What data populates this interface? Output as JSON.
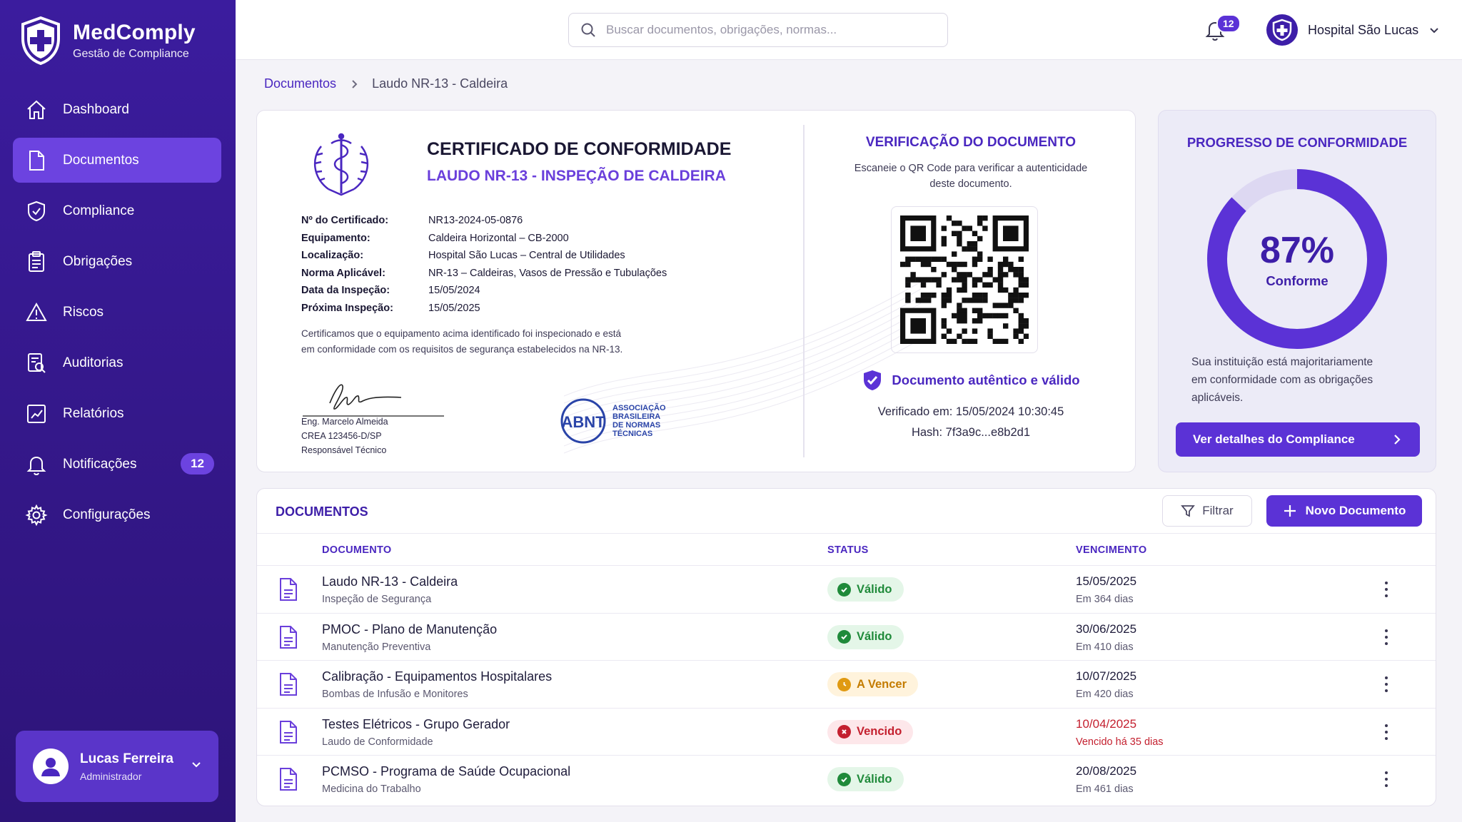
{
  "brand": {
    "name": "MedComply",
    "subtitle": "Gestão de Compliance"
  },
  "sidebar": {
    "items": [
      {
        "label": "Dashboard",
        "icon": "home-icon"
      },
      {
        "label": "Documentos",
        "icon": "document-icon",
        "active": true
      },
      {
        "label": "Compliance",
        "icon": "shield-check-icon"
      },
      {
        "label": "Obrigações",
        "icon": "clipboard-icon"
      },
      {
        "label": "Riscos",
        "icon": "warning-icon"
      },
      {
        "label": "Auditorias",
        "icon": "audit-icon"
      },
      {
        "label": "Relatórios",
        "icon": "chart-icon"
      },
      {
        "label": "Notificações",
        "icon": "bell-icon",
        "badge": "12"
      },
      {
        "label": "Configurações",
        "icon": "gear-icon"
      }
    ],
    "user": {
      "name": "Lucas Ferreira",
      "role": "Administrador"
    }
  },
  "topbar": {
    "search_placeholder": "Buscar documentos, obrigações, normas...",
    "notification_count": "12",
    "organization": "Hospital São Lucas"
  },
  "breadcrumb": {
    "parent": "Documentos",
    "current": "Laudo NR-13 - Caldeira"
  },
  "certificate": {
    "title": "CERTIFICADO DE CONFORMIDADE",
    "subtitle": "LAUDO NR-13 - INSPEÇÃO DE CALDEIRA",
    "fields": [
      {
        "label": "Nº do Certificado:",
        "value": "NR13-2024-05-0876"
      },
      {
        "label": "Equipamento:",
        "value": "Caldeira Horizontal – CB-2000"
      },
      {
        "label": "Localização:",
        "value": "Hospital São Lucas – Central de Utilidades"
      },
      {
        "label": "Norma Aplicável:",
        "value": "NR-13 – Caldeiras, Vasos de Pressão e Tubulações"
      },
      {
        "label": "Data da Inspeção:",
        "value": "15/05/2024"
      },
      {
        "label": "Próxima Inspeção:",
        "value": "15/05/2025"
      }
    ],
    "statement_line1": "Certificamos que o equipamento acima identificado foi inspecionado e está",
    "statement_line2": "em conformidade com os requisitos de segurança estabelecidos na NR-13.",
    "signer_name": "Eng. Marcelo Almeida",
    "signer_crea": "CREA 123456-D/SP",
    "signer_role": "Responsável Técnico",
    "seal": {
      "mark": "ABNT",
      "line1": "ASSOCIAÇÃO",
      "line2": "BRASILEIRA",
      "line3": "DE NORMAS",
      "line4": "TÉCNICAS"
    }
  },
  "verification": {
    "title": "VERIFICAÇÃO DO DOCUMENTO",
    "desc_line1": "Escaneie o QR Code para verificar a autenticidade",
    "desc_line2": "deste documento.",
    "status": "Documento autêntico e válido",
    "verified_at": "Verificado em: 15/05/2024 10:30:45",
    "hash": "Hash: 7f3a9c...e8b2d1"
  },
  "progress": {
    "title": "PROGRESSO DE CONFORMIDADE",
    "percent": 87,
    "percent_label": "87%",
    "status_label": "Conforme",
    "desc_line1": "Sua instituição está majoritariamente",
    "desc_line2": "em conformidade com as obrigações",
    "desc_line3": "aplicáveis.",
    "button": "Ver detalhes do Compliance"
  },
  "documents": {
    "title": "DOCUMENTOS",
    "filter_label": "Filtrar",
    "new_label": "Novo Documento",
    "columns": {
      "document": "DOCUMENTO",
      "status": "STATUS",
      "due": "VENCIMENTO"
    },
    "rows": [
      {
        "name": "Laudo NR-13 - Caldeira",
        "sub": "Inspeção de Segurança",
        "status": "Válido",
        "status_type": "ok",
        "due": "15/05/2025",
        "rel": "Em 364 dias"
      },
      {
        "name": "PMOC - Plano de Manutenção",
        "sub": "Manutenção Preventiva",
        "status": "Válido",
        "status_type": "ok",
        "due": "30/06/2025",
        "rel": "Em 410 dias"
      },
      {
        "name": "Calibração - Equipamentos Hospitalares",
        "sub": "Bombas de Infusão e Monitores",
        "status": "A Vencer",
        "status_type": "warn",
        "due": "10/07/2025",
        "rel": "Em 420 dias"
      },
      {
        "name": "Testes Elétricos - Grupo Gerador",
        "sub": "Laudo de Conformidade",
        "status": "Vencido",
        "status_type": "bad",
        "due": "10/04/2025",
        "rel": "Vencido há 35 dias"
      },
      {
        "name": "PCMSO - Programa de Saúde Ocupacional",
        "sub": "Medicina do Trabalho",
        "status": "Válido",
        "status_type": "ok",
        "due": "20/08/2025",
        "rel": "Em 461 dias"
      }
    ]
  },
  "colors": {
    "brand": "#3b1c9e",
    "accent": "#5b32d6",
    "ok": "#1f8a3a",
    "warn": "#c47c00",
    "bad": "#c4202f"
  }
}
